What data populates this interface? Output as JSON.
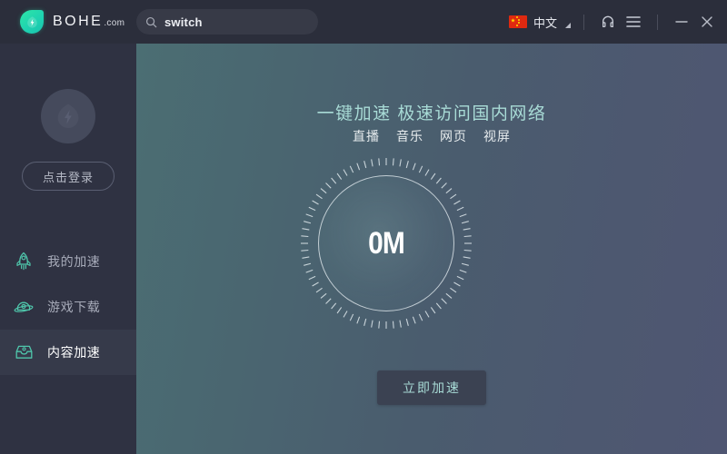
{
  "titlebar": {
    "brand_name": "BOHE",
    "brand_tld": ".com",
    "brand_icon": "bohe-droplet-logo",
    "search": {
      "icon": "search-icon",
      "value": "switch",
      "placeholder": "switch"
    },
    "language": {
      "flag_icon": "china-flag-icon",
      "label": "中文",
      "caret_icon": "triangle-down-icon"
    },
    "headphone_icon": "headphone-icon",
    "menu_icon": "hamburger-menu-icon",
    "minimize_icon": "minimize-icon",
    "close_icon": "close-icon"
  },
  "sidebar": {
    "avatar_icon": "user-avatar-placeholder",
    "login_label": "点击登录",
    "items": [
      {
        "label": "我的加速",
        "icon": "rocket-icon",
        "active": false
      },
      {
        "label": "游戏下载",
        "icon": "planet-icon",
        "active": false
      },
      {
        "label": "内容加速",
        "icon": "inbox-icon",
        "active": true
      }
    ]
  },
  "main": {
    "headline": "一键加速 极速访问国内网络",
    "categories": [
      "直播",
      "音乐",
      "网页",
      "视屏"
    ],
    "gauge": {
      "value": "0M",
      "tick_count": 72
    },
    "cta_label": "立即加速"
  },
  "colors": {
    "brand_teal": "#2ee6a8",
    "titlebar_bg": "#2b2e3b",
    "sidebar_bg": "#2f3242",
    "sidebar_active_bg": "#363a4a",
    "accent_text": "#a8dbd6",
    "main_gradient_start": "#4b6e73",
    "main_gradient_end": "#4f5672",
    "flag_red": "#de2910",
    "flag_yellow": "#ffde00"
  }
}
